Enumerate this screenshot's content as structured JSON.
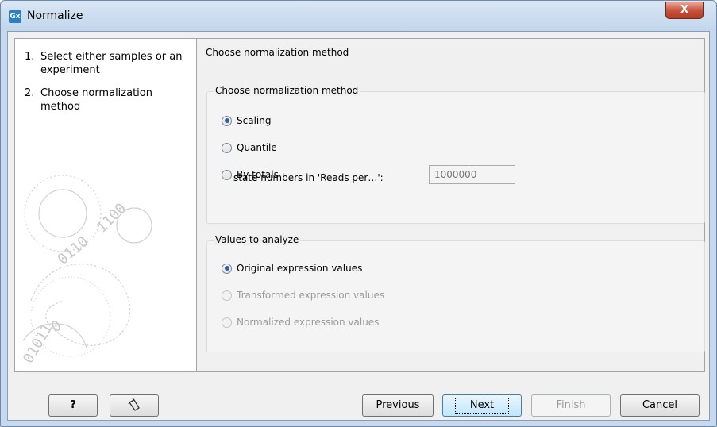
{
  "window": {
    "icon_text": "Gx",
    "title": "Normalize",
    "close_glyph": "X"
  },
  "steps": [
    {
      "num": "1.",
      "label": "Select either samples or an experiment"
    },
    {
      "num": "2.",
      "label": "Choose normalization method"
    }
  ],
  "content": {
    "heading": "Choose normalization method",
    "method_group": {
      "title": "Choose normalization method",
      "options": [
        "Scaling",
        "Quantile",
        "By totals"
      ],
      "selected": "Scaling",
      "field_label": "state numbers in 'Reads per…':",
      "field_value": "1000000"
    },
    "values_group": {
      "title": "Values to analyze",
      "options": [
        "Original expression values",
        "Transformed expression values",
        "Normalized expression values"
      ],
      "selected": "Original expression values"
    }
  },
  "footer": {
    "help_label": "?",
    "previous_label": "Previous",
    "next_label": "Next",
    "finish_label": "Finish",
    "cancel_label": "Cancel"
  },
  "icons": {
    "app": "app-logo-icon",
    "close": "close-icon",
    "help": "help-icon",
    "reset": "reset-icon",
    "decoration": "binary-swirl-decoration"
  }
}
